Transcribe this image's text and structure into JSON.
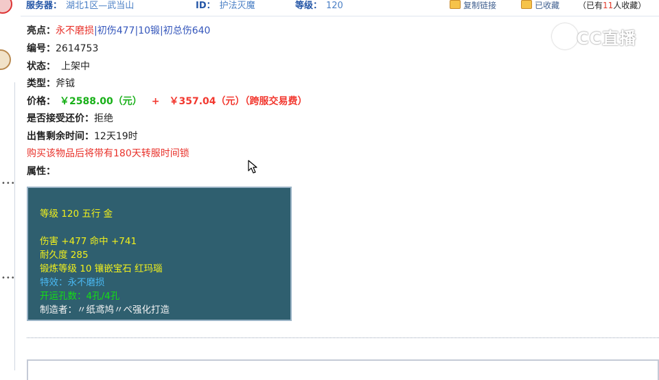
{
  "header": {
    "server_label": "服务器：",
    "server_value": "湖北1区—武当山",
    "id_label": "ID：",
    "id_value": "护法灭魔",
    "level_label": "等级：",
    "level_value": "120",
    "copy_link": "复制链接",
    "favorited": "已收藏",
    "fav_prefix": "（已有",
    "fav_count": "11",
    "fav_suffix": "人收藏）"
  },
  "info": {
    "highlight_label": "亮点：",
    "highlight_1": "永不磨损",
    "highlight_2": "初伤477",
    "highlight_3": "10锻",
    "highlight_4": "初总伤640",
    "number_label": "编号：",
    "number_value": "2614753",
    "status_label": "状态：",
    "status_value": "上架中",
    "type_label": "类型：",
    "type_value": "斧钺",
    "price_label": "价格：",
    "price_main": "￥2588.00（元）",
    "price_plus": "+",
    "price_fee": "￥357.04（元）（跨服交易费）",
    "counter_label": "是否接受还价：",
    "counter_value": "拒绝",
    "time_label": "出售剩余时间：",
    "time_value": "12天19时",
    "warning": "购买该物品后将带有180天转服时间锁",
    "attr_label": "属性："
  },
  "attributes": {
    "line1": "等级 120 五行 金",
    "line2": "伤害 +477 命中 +741",
    "line3": "耐久度 285",
    "line4": "锻炼等级 10 镶嵌宝石 红玛瑙",
    "line5": "特效：永不磨损",
    "line6": "开运孔数：4孔/4孔",
    "line7": "制造者：〃纸鸢鸠〃ぺ强化打造"
  },
  "watermark": {
    "text": "CC直播"
  },
  "colors": {
    "header_blue": "#2355a6",
    "highlight_red": "#e8312a",
    "price_green": "#18b018",
    "price_red": "#f2382f",
    "attr_bg": "#2f5f6f",
    "attr_yellow": "#f2f01c",
    "attr_cyan": "#4ab8f2",
    "attr_green": "#14e014"
  }
}
